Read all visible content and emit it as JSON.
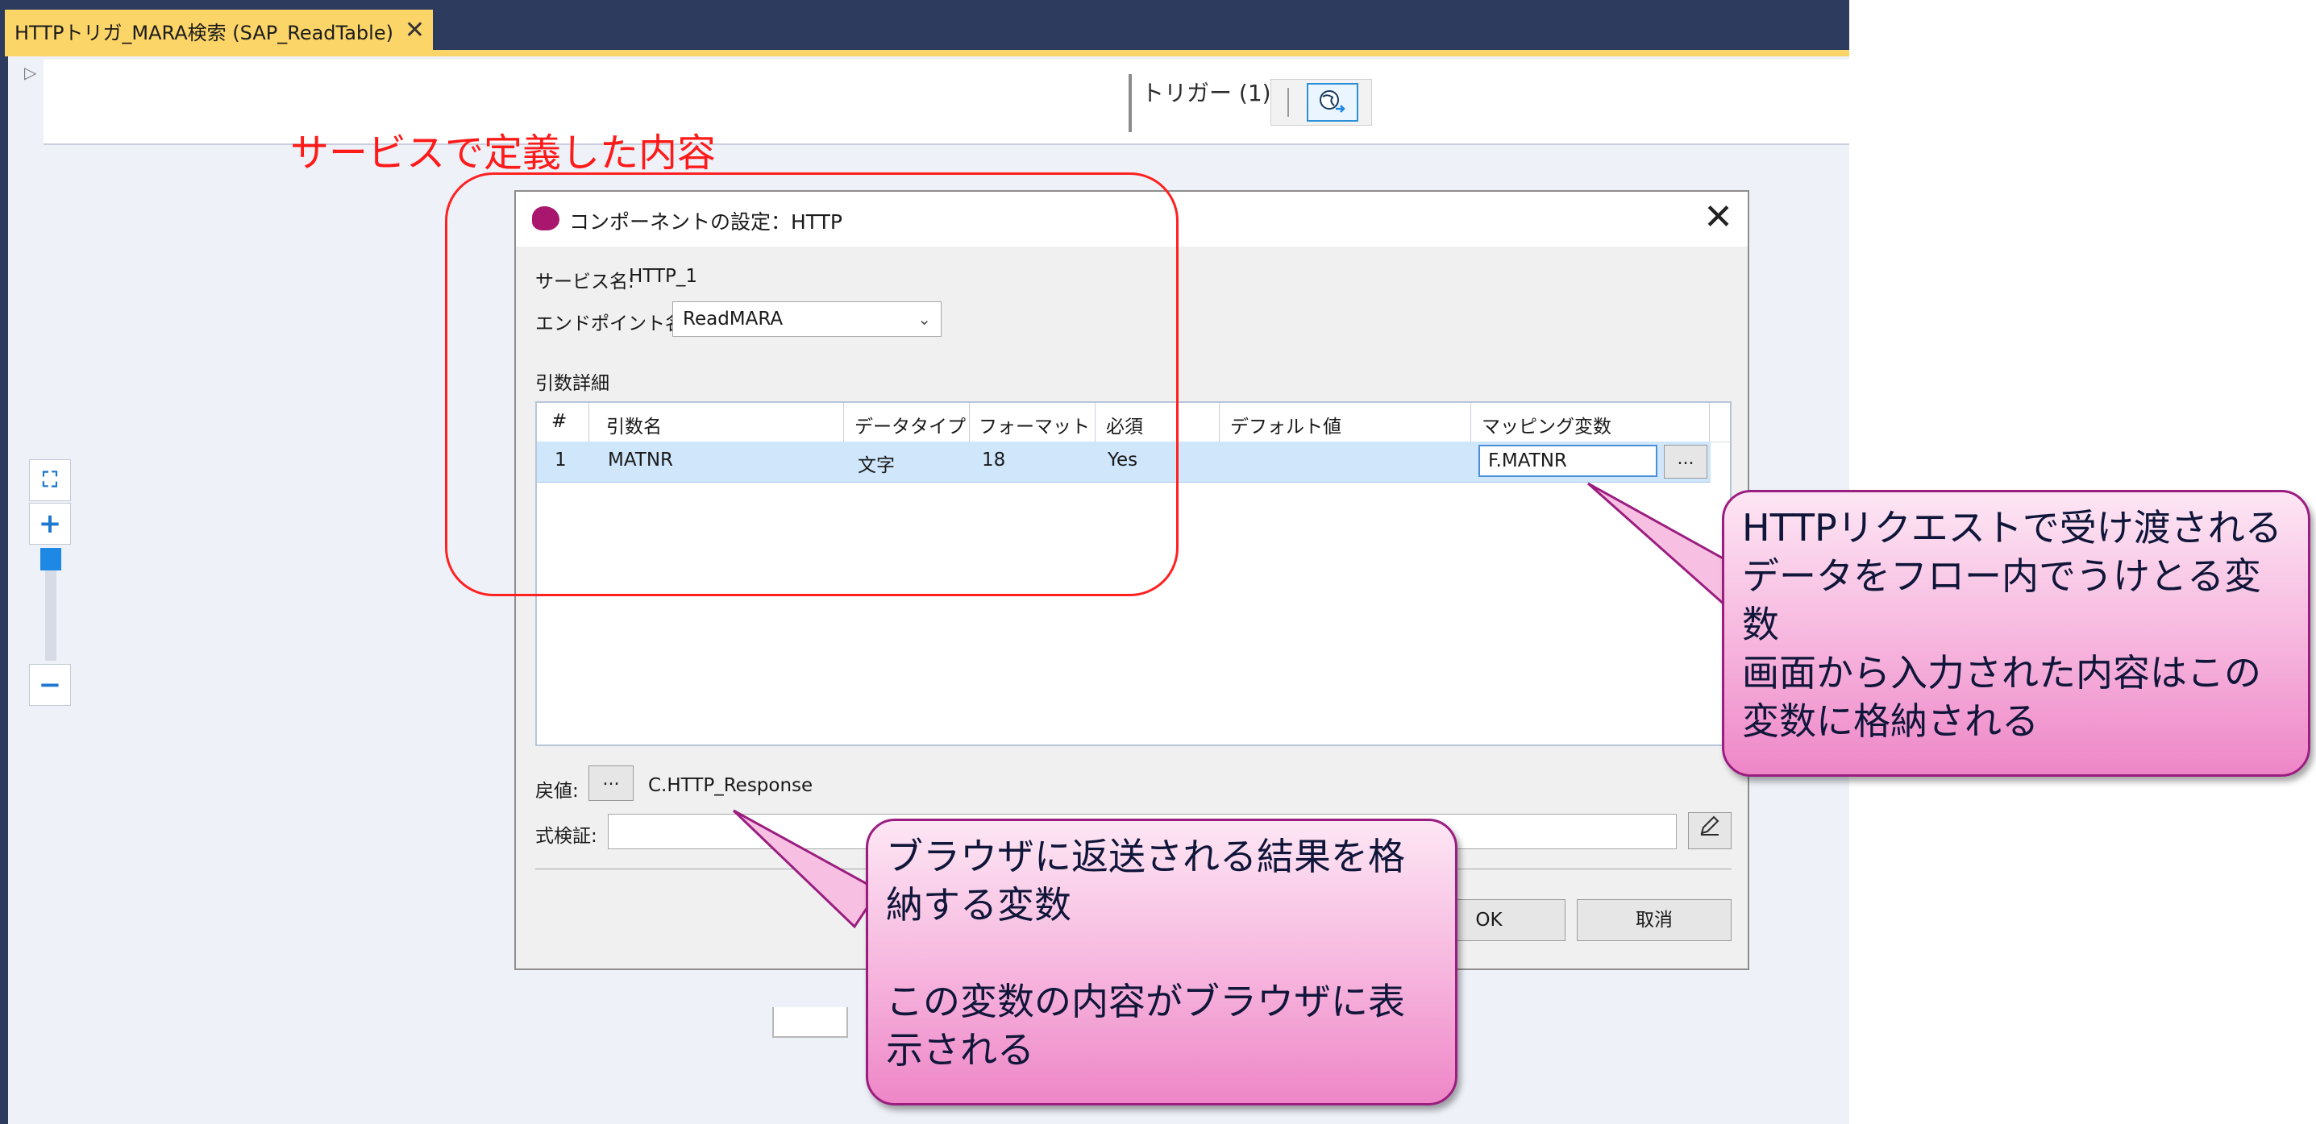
{
  "tab": {
    "title": "HTTPトリガ_MARA検索 (SAP_ReadTable)",
    "close_glyph": "✕"
  },
  "toolbar": {
    "trigger_label": "トリガー (1)",
    "trigger_icon": "globe-arrows-icon"
  },
  "zoom": {
    "fit_glyph": "⛶",
    "zoom_in": "+",
    "zoom_out": "−",
    "level": 0.1
  },
  "dialog": {
    "title": "コンポーネントの設定：HTTP",
    "close_glyph": "✕",
    "service_label": "サービス名:",
    "service_value": "HTTP_1",
    "endpoint_label": "エンドポイント名:",
    "endpoint_value": "ReadMARA",
    "args_label": "引数詳細",
    "columns": [
      "#",
      "引数名",
      "データタイプ",
      "フォーマット",
      "必須",
      "デフォルト値",
      "マッピング変数"
    ],
    "rows": [
      {
        "num": "1",
        "name": "MATNR",
        "type": "文字",
        "format": "18",
        "required": "Yes",
        "default": "",
        "mapping": "F.MATNR"
      }
    ],
    "ellipsis": "...",
    "return_label": "戻値:",
    "return_value": "C.HTTP_Response",
    "expr_label": "式検証:",
    "expr_value": "",
    "ok_label": "OK",
    "cancel_label": "取消"
  },
  "annotations": {
    "red_title": "サービスで定義した内容",
    "callout_right": "HTTPリクエストで受け渡されるデータをフロー内でうけとる変数\n画面から入力された内容はこの変数に格納される",
    "callout_bottom": "ブラウザに返送される結果を格納する変数\n\nこの変数の内容がブラウザに表示される"
  },
  "colors": {
    "tab_accent": "#fcd568",
    "red": "#ff1a1a",
    "callout_border": "#9b1d80",
    "selection": "#cfe6fb"
  }
}
